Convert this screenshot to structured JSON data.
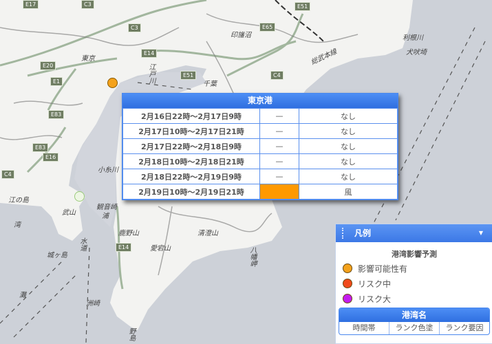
{
  "map": {
    "labels": {
      "tokyo": "東京",
      "chiba": "千葉",
      "edogawa": "江戸川",
      "inbanuma": "印旛沼",
      "tonegawa": "利根川",
      "inubosaki": "犬吠埼",
      "sobu_line": "総武本線",
      "enoshima": "江の島",
      "kannonzaki": "観音崎",
      "uraga": "浦",
      "koitogawa": "小糸川",
      "kanozan": "鹿野山",
      "kiyosumi": "清澄山",
      "atagoyama": "愛宕山",
      "yawata": "八幡岬",
      "suzaki": "洲崎",
      "nojima": "野島",
      "jogashima": "城ヶ島",
      "takeyama": "武山",
      "bay": "湾",
      "strait": "水道",
      "nada": "灘"
    },
    "shields": [
      "E17",
      "C3",
      "E51",
      "E65",
      "E20",
      "C3",
      "E14",
      "E51",
      "E1",
      "E83",
      "E83",
      "E16",
      "C4",
      "E14",
      "C4"
    ]
  },
  "popup": {
    "title": "東京港",
    "rows": [
      {
        "time": "2月16日22時～2月17日9時",
        "rank": "—",
        "factor": "なし"
      },
      {
        "time": "2月17日10時～2月17日21時",
        "rank": "—",
        "factor": "なし"
      },
      {
        "time": "2月17日22時～2月18日9時",
        "rank": "—",
        "factor": "なし"
      },
      {
        "time": "2月18日10時～2月18日21時",
        "rank": "—",
        "factor": "なし"
      },
      {
        "time": "2月18日22時～2月19日9時",
        "rank": "—",
        "factor": "なし"
      },
      {
        "time": "2月19日10時～2月19日21時",
        "rank": "",
        "factor": "風",
        "rank_color": "#ff9900"
      }
    ]
  },
  "legend": {
    "title": "凡例",
    "subtitle": "港湾影響予測",
    "items": [
      {
        "label": "影響可能性有",
        "color": "#f4a21c"
      },
      {
        "label": "リスク中",
        "color": "#f04a1c"
      },
      {
        "label": "リスク大",
        "color": "#c41cf0"
      }
    ],
    "sample": {
      "title": "港湾名",
      "cols": [
        "時間帯",
        "ランク色塗",
        "ランク要因"
      ]
    }
  },
  "colors": {
    "sea": "#cdd1d8",
    "land": "#f3f3f1",
    "accent": "#3b7de8"
  }
}
